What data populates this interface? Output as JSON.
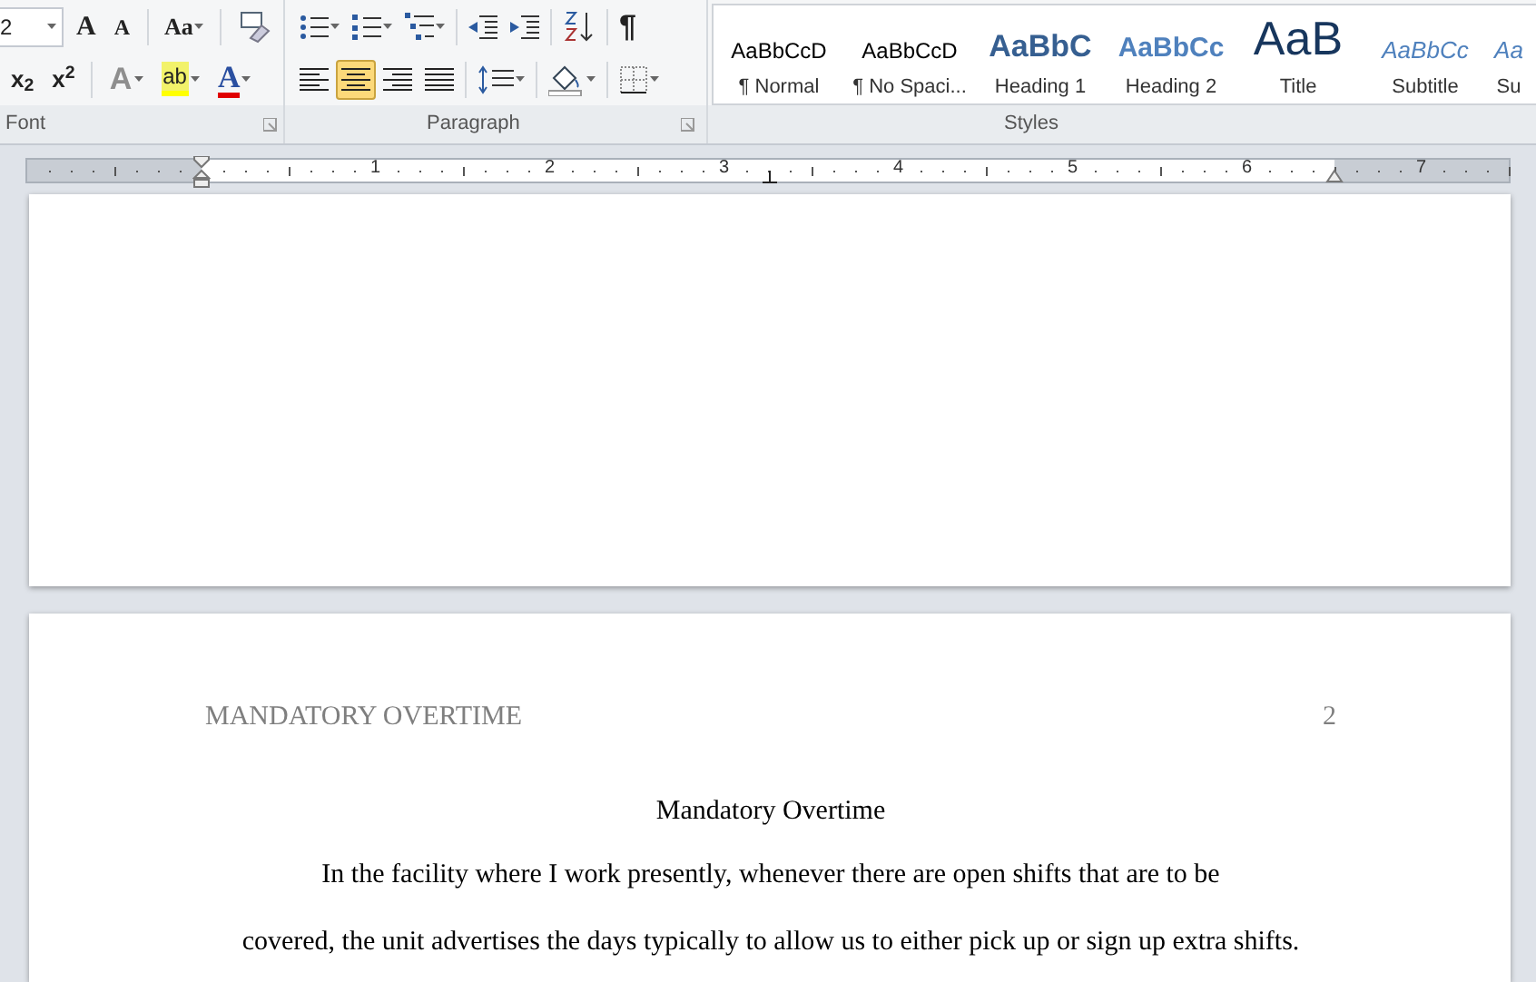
{
  "ribbon": {
    "font_group": {
      "font_size": "2",
      "label": "Font",
      "row1": [
        {
          "kind": "grow",
          "text": "A"
        },
        {
          "kind": "shrink",
          "text": "A"
        },
        {
          "kind": "case",
          "text": "Aa"
        },
        {
          "kind": "clear"
        }
      ],
      "row2": [
        {
          "kind": "sub",
          "text": "x$_{2}$"
        },
        {
          "kind": "sup",
          "text": "x$^{2}$"
        },
        {
          "kind": "effects",
          "text": "A"
        },
        {
          "kind": "highlight",
          "text": "ab"
        },
        {
          "kind": "fontcolor",
          "text": "A"
        }
      ]
    },
    "paragraph_group": {
      "label": "Paragraph",
      "row1": [
        {
          "kind": "bullets"
        },
        {
          "kind": "numbering"
        },
        {
          "kind": "multilevel"
        },
        {
          "kind": "outdent"
        },
        {
          "kind": "indent"
        },
        {
          "kind": "sort"
        },
        {
          "kind": "marks",
          "text": "¶"
        }
      ],
      "alignment": [
        {
          "kind": "left",
          "selected": false
        },
        {
          "kind": "center",
          "selected": true
        },
        {
          "kind": "right",
          "selected": false
        },
        {
          "kind": "justify",
          "selected": false
        }
      ],
      "row2": [
        {
          "kind": "spacing"
        },
        {
          "kind": "shading"
        },
        {
          "kind": "borders"
        }
      ]
    },
    "styles_group": {
      "label": "Styles",
      "items": [
        {
          "kind": "body",
          "preview": "AaBbCcD",
          "name": "¶ Normal"
        },
        {
          "kind": "body",
          "preview": "AaBbCcD",
          "name": "¶ No Spaci..."
        },
        {
          "kind": "heading1",
          "preview": "AaBbC",
          "name": "Heading 1"
        },
        {
          "kind": "heading2",
          "preview": "AaBbCc",
          "name": "Heading 2"
        },
        {
          "kind": "title",
          "preview": "AaB",
          "name": "Title"
        },
        {
          "kind": "subtitle",
          "preview": "AaBbCc",
          "name": "Subtitle"
        },
        {
          "kind": "subtitle",
          "preview": "Aa",
          "name": "Su"
        }
      ]
    }
  },
  "ruler": {
    "ticks": [
      "1",
      "2",
      "3",
      "4",
      "5",
      "6",
      "7"
    ]
  },
  "page": {
    "header": "MANDATORY OVERTIME",
    "page_number": "2",
    "title": "Mandatory Overtime",
    "lines": [
      "In the facility where I work presently, whenever there are open shifts that are to be",
      "covered, the unit advertises the days typically to allow us to either pick up or sign up extra shifts."
    ]
  }
}
